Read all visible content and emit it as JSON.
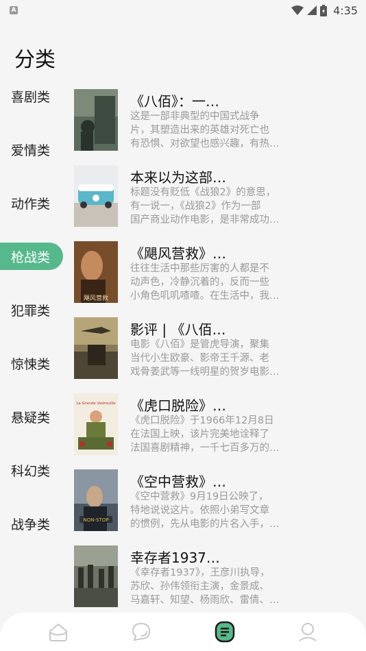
{
  "status_bar": {
    "time": "4:35",
    "left_badge": "A",
    "icons": [
      "wifi-icon",
      "signal-icon",
      "battery-icon"
    ]
  },
  "page_title": "分类",
  "categories": [
    {
      "label": "喜剧类",
      "active": false
    },
    {
      "label": "爱情类",
      "active": false
    },
    {
      "label": "动作类",
      "active": false
    },
    {
      "label": "枪战类",
      "active": true
    },
    {
      "label": "犯罪类",
      "active": false
    },
    {
      "label": "惊悚类",
      "active": false
    },
    {
      "label": "悬疑类",
      "active": false
    },
    {
      "label": "科幻类",
      "active": false
    },
    {
      "label": "战争类",
      "active": false
    }
  ],
  "articles": [
    {
      "title": "《八佰》：一…",
      "desc_lines": [
        "这是一部非典型的中国式战争",
        "片，其塑造出来的英雄对死亡也",
        "有恐惧、对欲望也感兴趣，有热…"
      ]
    },
    {
      "title": "本来以为这部…",
      "desc_lines": [
        "标题没有贬低《战狼2》的意思，",
        "有一说一，《战狼2》作为一部",
        "国产商业动作电影，是非常成功…"
      ]
    },
    {
      "title": "《飓风营救》…",
      "desc_lines": [
        "往往生活中那些厉害的人都是不",
        "动声色，冷静沉着的，反而一些",
        "小角色叽叽喳喳。在生活中，我…"
      ]
    },
    {
      "title": "影评 | 《八佰…",
      "desc_lines": [
        "电影《八佰》是管虎导演，聚集",
        "当代小生欧豪、影帝王千源、老",
        "戏骨姜武等一线明星的贺岁电影…"
      ]
    },
    {
      "title": "《虎口脱险》…",
      "desc_lines": [
        "《虎口脱险》于1966年12月8日",
        "在法国上映，该片完美地诠释了",
        "法国喜剧精神，一千七百多万的…"
      ]
    },
    {
      "title": "《空中营救》…",
      "desc_lines": [
        "《空中营救》9月19日公映了，",
        "特地说说这片。依照小弟写文章",
        "的惯例，先从电影的片名入手，…"
      ]
    },
    {
      "title": "幸存者1937…",
      "desc_lines": [
        "《幸存者1937》，王彦川执导，",
        "苏欣、孙伟领衔主演，金景成、",
        "马嘉轩、知望、杨雨欣、雷倩、…"
      ]
    }
  ],
  "poster_texts": {
    "poster3": "飓风营救",
    "poster5": "La Grande Vadrouille",
    "poster6": "NON-STOP"
  },
  "bottom_nav": [
    {
      "icon": "home-icon",
      "active": false
    },
    {
      "icon": "chat-icon",
      "active": false
    },
    {
      "icon": "category-icon",
      "active": true
    },
    {
      "icon": "profile-icon",
      "active": false
    }
  ],
  "colors": {
    "accent": "#57b88b",
    "background": "#f5f5f5",
    "muted_text": "#9a9a9a"
  }
}
